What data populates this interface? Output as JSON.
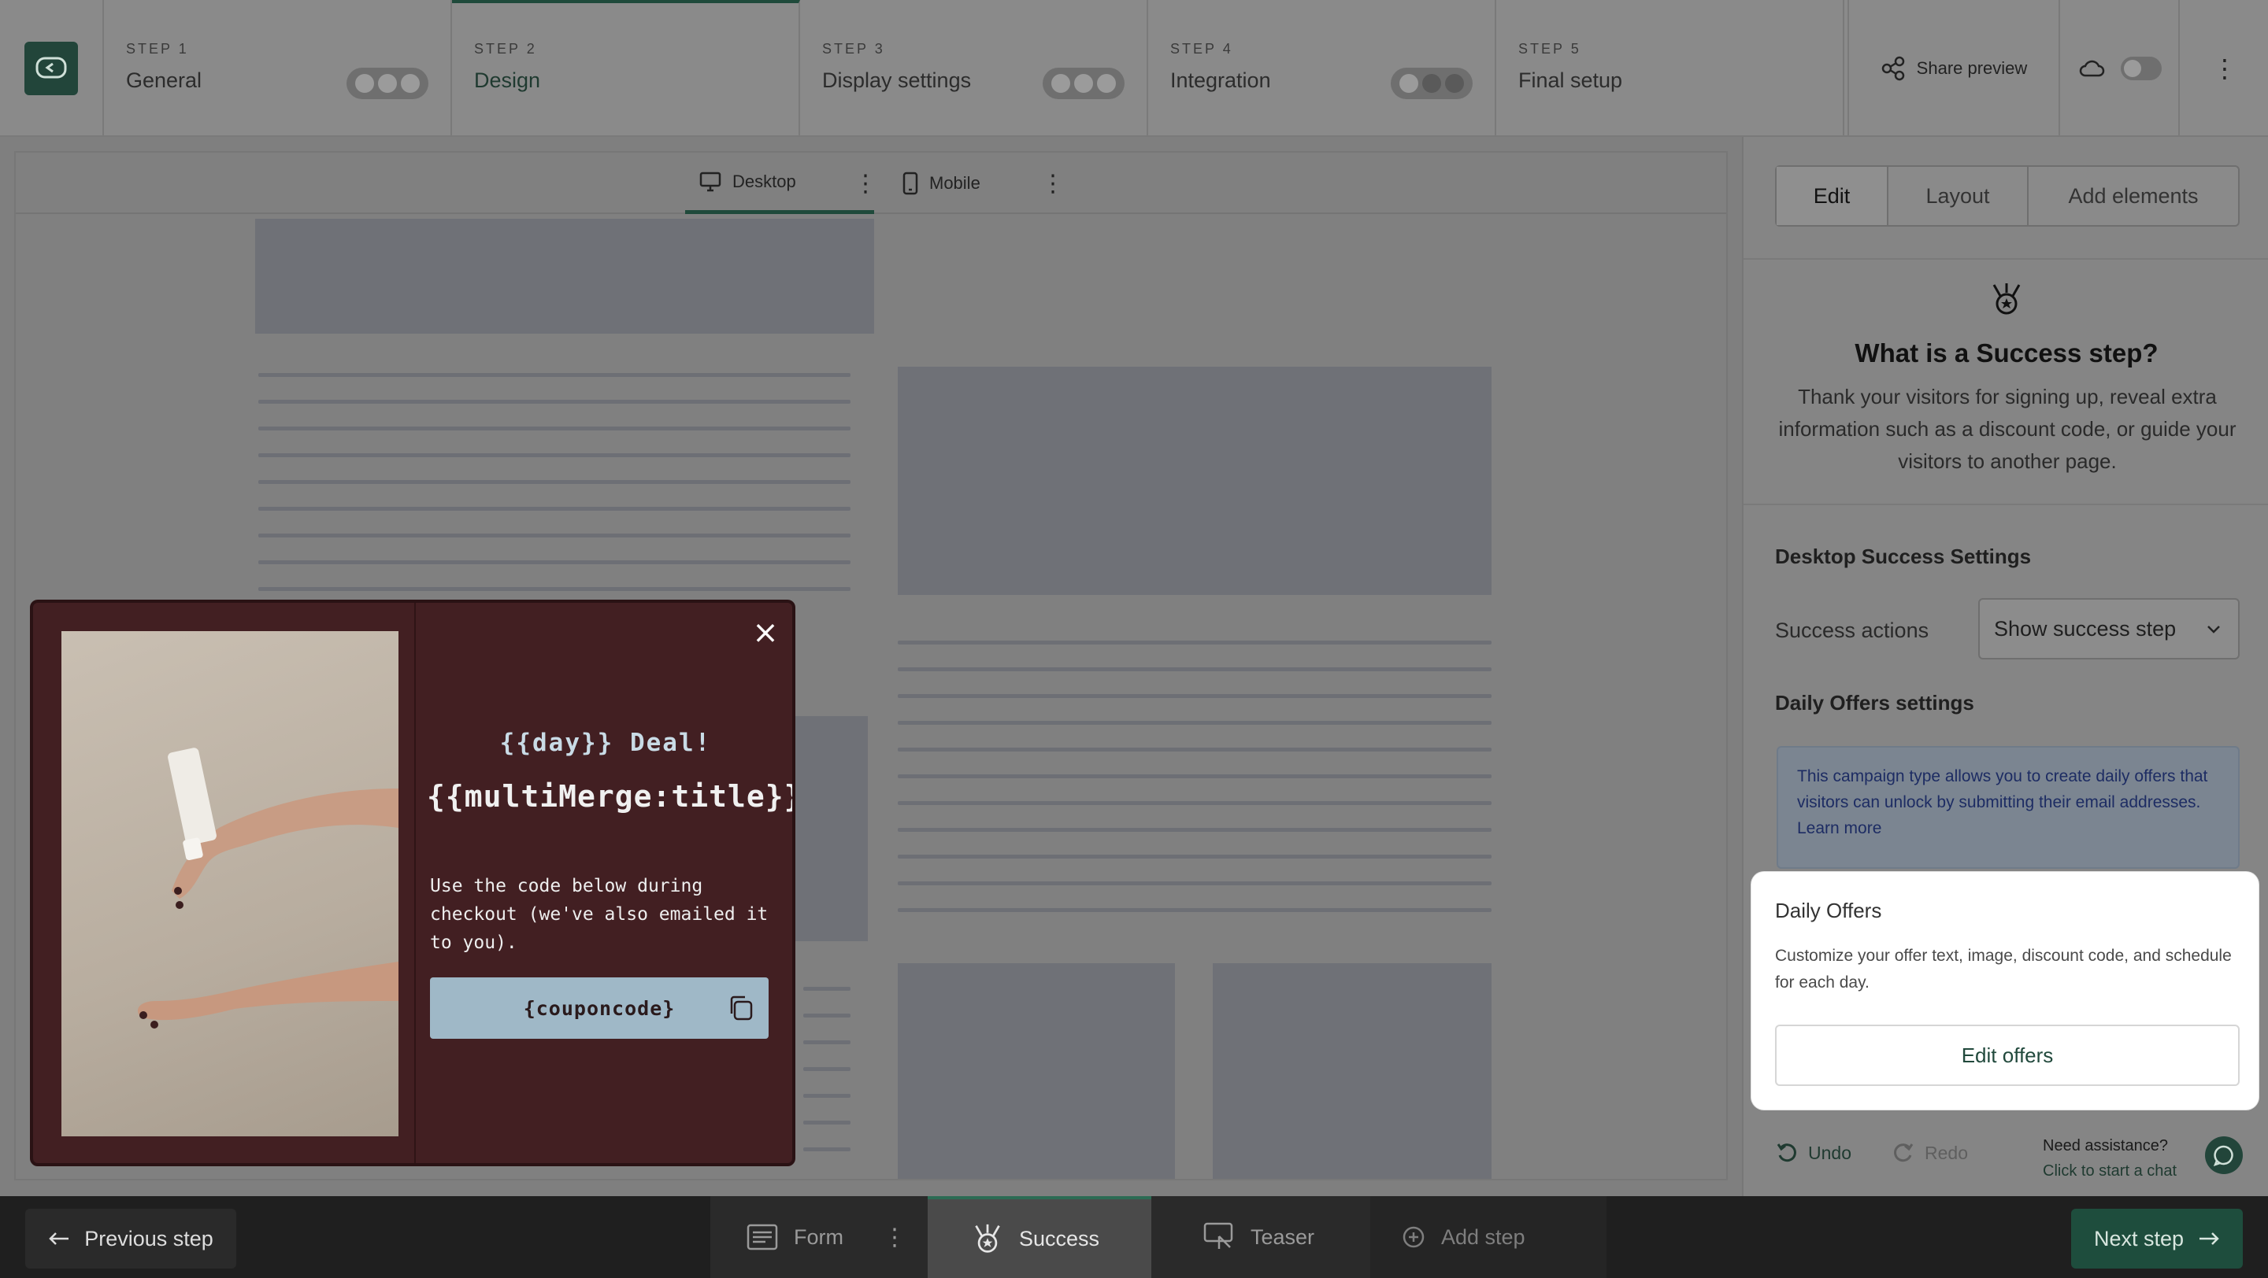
{
  "steps": [
    {
      "num": "STEP 1",
      "name": "General"
    },
    {
      "num": "STEP 2",
      "name": "Design"
    },
    {
      "num": "STEP 3",
      "name": "Display settings"
    },
    {
      "num": "STEP 4",
      "name": "Integration"
    },
    {
      "num": "STEP 5",
      "name": "Final setup"
    }
  ],
  "header": {
    "share_label": "Share preview"
  },
  "view_tabs": {
    "desktop": "Desktop",
    "mobile": "Mobile"
  },
  "popup": {
    "deal": "{{day}} Deal!",
    "title": "{{multiMerge:title}}",
    "description": "Use the code below during checkout (we've also emailed it to you).",
    "coupon": "{couponcode}"
  },
  "panel": {
    "tabs": [
      "Edit",
      "Layout",
      "Add elements"
    ],
    "success_title": "What is a Success step?",
    "success_desc": "Thank your visitors for signing up, reveal extra information such as a discount code, or guide your visitors to another page.",
    "desktop_settings_title": "Desktop Success Settings",
    "success_actions_label": "Success actions",
    "success_actions_value": "Show success step",
    "daily_settings_title": "Daily Offers settings",
    "info_text": "This campaign type allows you to create daily offers that visitors can unlock by submitting their email addresses.",
    "info_link": "Learn more",
    "offers_title": "Daily Offers",
    "offers_desc": "Customize your offer text, image, discount code, and schedule for each day.",
    "edit_offers": "Edit offers",
    "undo": "Undo",
    "redo": "Redo",
    "assist_title": "Need assistance?",
    "assist_sub": "Click to start a chat"
  },
  "bottom": {
    "prev": "Previous step",
    "form": "Form",
    "success": "Success",
    "teaser": "Teaser",
    "add_step": "Add step",
    "next": "Next step"
  },
  "colors": {
    "accent": "#1e4d3d",
    "popup_bg": "#421f22",
    "coupon_bg": "#9fb8c7",
    "info_text": "#1d2c63"
  }
}
